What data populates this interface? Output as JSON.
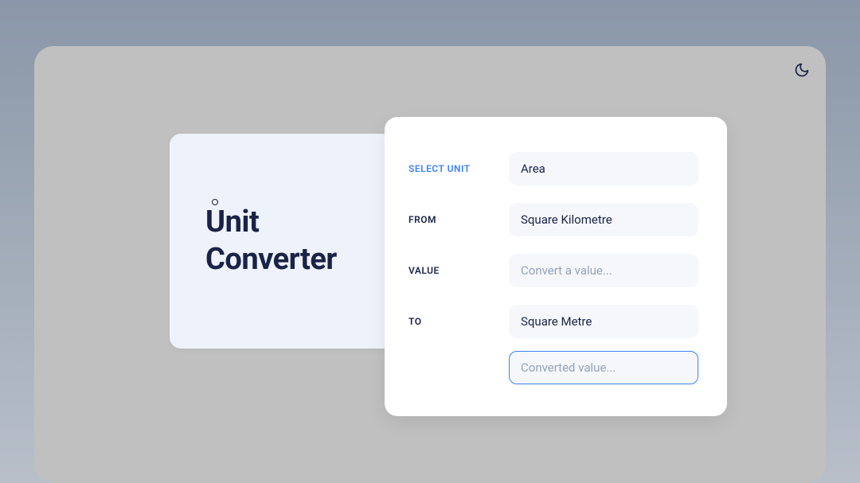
{
  "title": {
    "line1_prefix": "U",
    "line1_suffix": "nit",
    "line2": "Converter"
  },
  "form": {
    "selectUnit": {
      "label": "SELECT UNIT",
      "value": "Area"
    },
    "from": {
      "label": "FROM",
      "value": "Square Kilometre"
    },
    "value": {
      "label": "VALUE",
      "placeholder": "Convert a value..."
    },
    "to": {
      "label": "TO",
      "value": "Square Metre"
    },
    "output": {
      "placeholder": "Converted value..."
    }
  }
}
